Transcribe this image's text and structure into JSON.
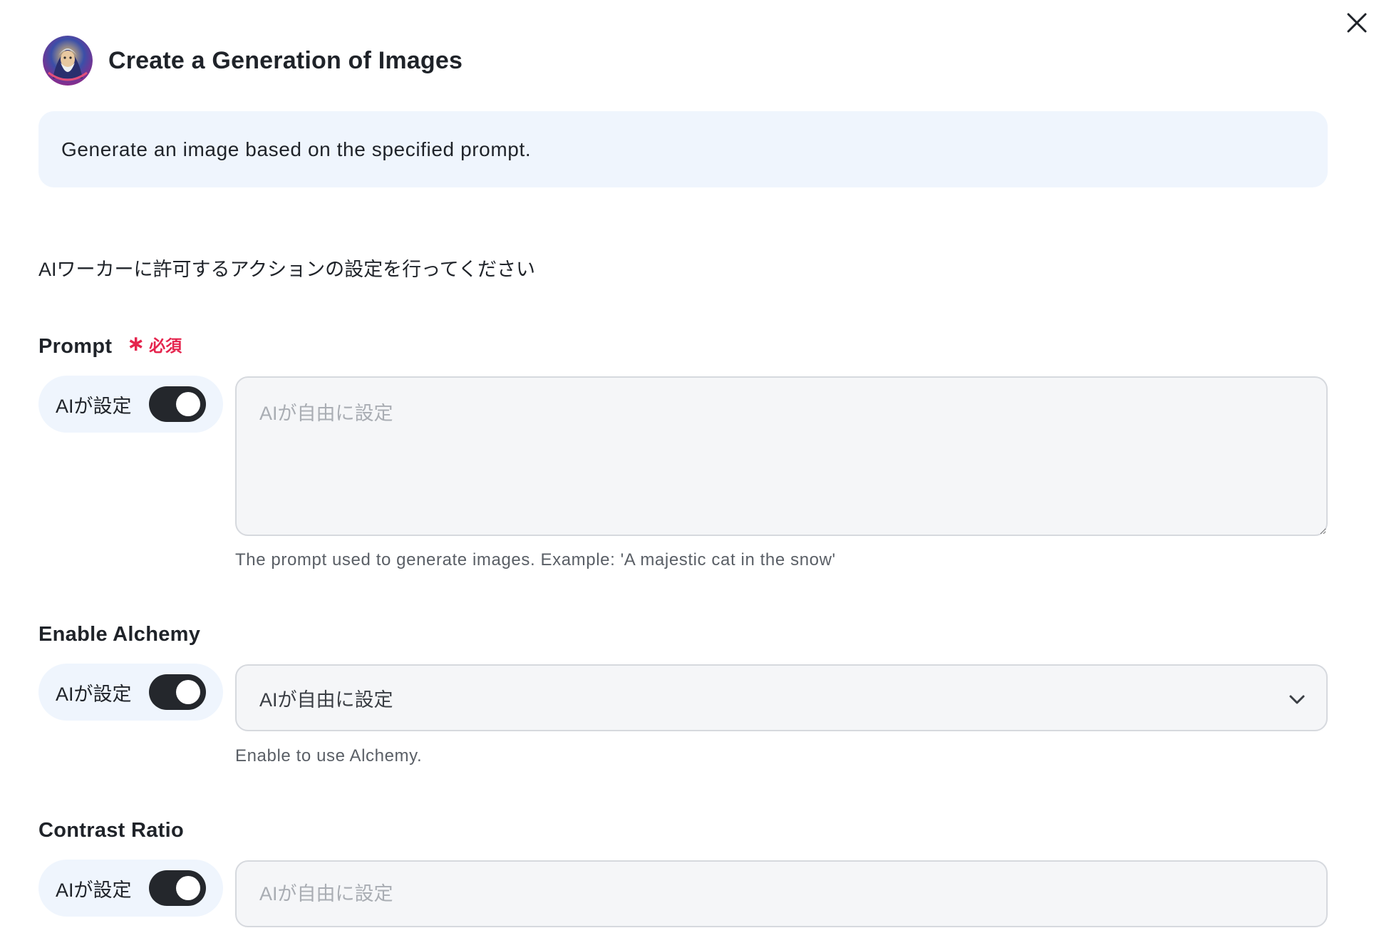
{
  "header": {
    "title": "Create a Generation of Images"
  },
  "description": "Generate an image based on the specified prompt.",
  "instruction": "AIワーカーに許可するアクションの設定を行ってください",
  "fields": [
    {
      "label": "Prompt",
      "required_label": "必須",
      "ai_toggle_label": "AIが設定",
      "ai_toggle_on": true,
      "placeholder": "AIが自由に設定",
      "help": "The prompt used to generate images. Example: 'A majestic cat in the snow'"
    },
    {
      "label": "Enable Alchemy",
      "ai_toggle_label": "AIが設定",
      "ai_toggle_on": true,
      "selected": "AIが自由に設定",
      "help": "Enable to use Alchemy."
    },
    {
      "label": "Contrast Ratio",
      "ai_toggle_label": "AIが設定",
      "ai_toggle_on": true,
      "placeholder": "AIが自由に設定"
    }
  ],
  "colors": {
    "accent_bg": "#eff5fd",
    "toggle_on": "#24272c",
    "required": "#e5244d"
  }
}
